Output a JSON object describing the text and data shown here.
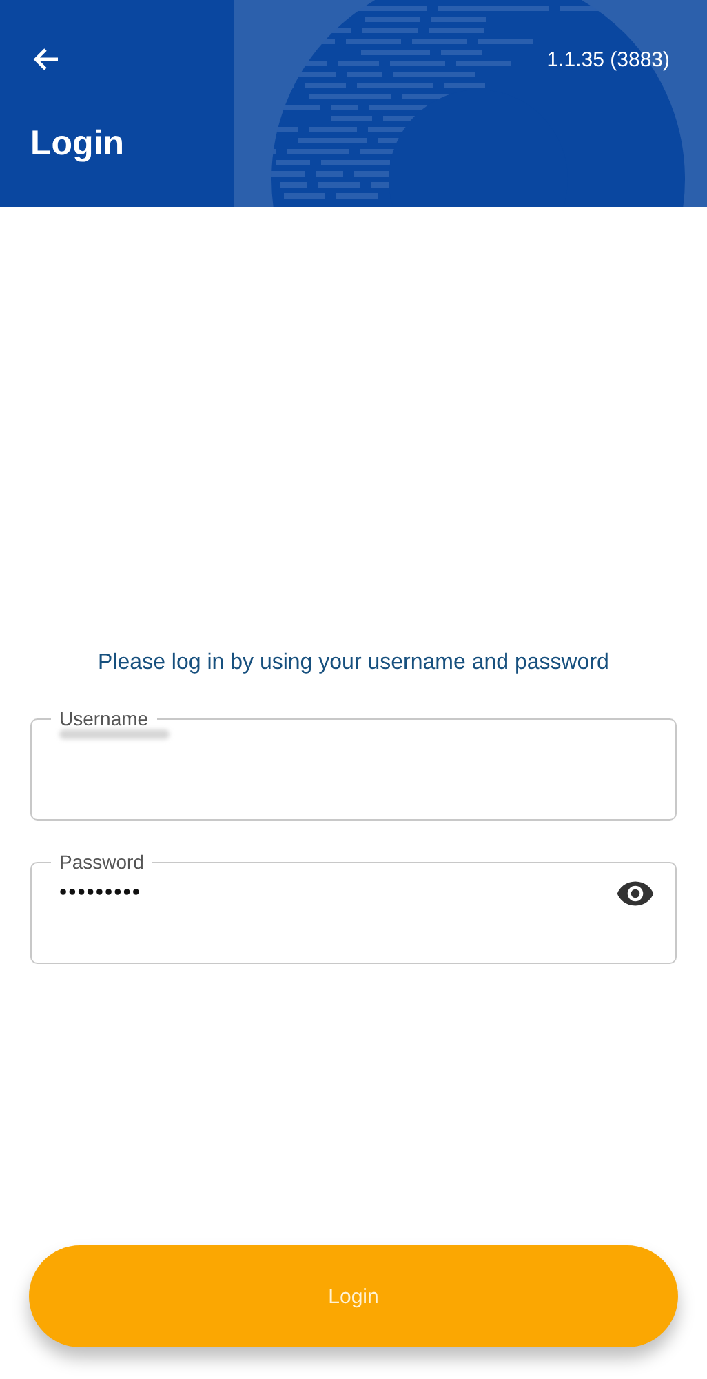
{
  "header": {
    "title": "Login",
    "version": "1.1.35 (3883)"
  },
  "message": "Please log in by using your username and password",
  "fields": [
    {
      "kind": "redacted",
      "label": "Username"
    },
    {
      "kind": "password",
      "label": "Password",
      "value": "•••••••••"
    }
  ],
  "button": {
    "label": "Login"
  }
}
